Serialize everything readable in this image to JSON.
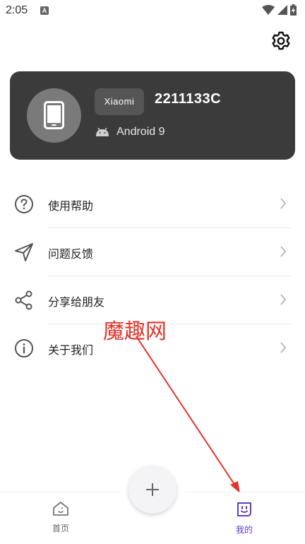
{
  "status_bar": {
    "time": "2:05",
    "notification_letter": "A"
  },
  "device": {
    "brand": "Xiaomi",
    "model": "2211133C",
    "os": "Android 9"
  },
  "menu": {
    "items": [
      {
        "label": "使用帮助",
        "icon": "help-circle-icon"
      },
      {
        "label": "问题反馈",
        "icon": "send-icon"
      },
      {
        "label": "分享给朋友",
        "icon": "share-icon"
      },
      {
        "label": "关于我们",
        "icon": "info-icon"
      }
    ]
  },
  "watermark": "魔趣网",
  "bottom_nav": {
    "home_label": "首页",
    "mine_label": "我的"
  },
  "colors": {
    "card_bg": "#3b3b3b",
    "accent": "#5b3fc4",
    "watermark": "#e5332a"
  }
}
